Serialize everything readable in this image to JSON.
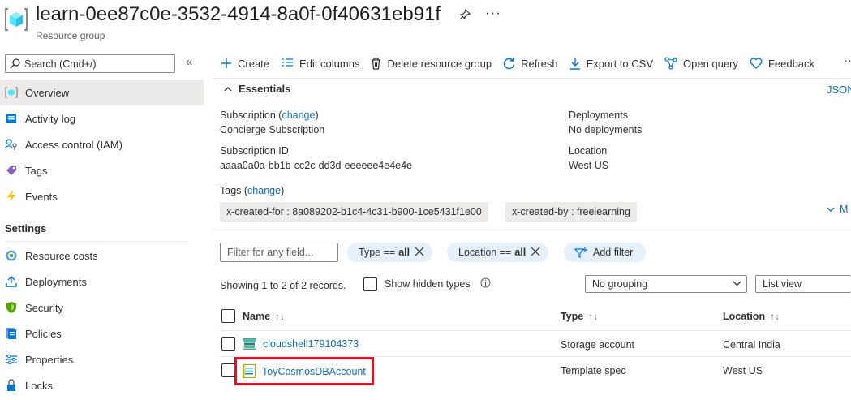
{
  "header": {
    "title": "learn-0ee87c0e-3532-4914-8a0f-0f40631eb91f",
    "subtitle": "Resource group",
    "more": "···"
  },
  "sidebar": {
    "search_placeholder": "Search (Cmd+/)",
    "collapse": "«",
    "items": [
      {
        "label": "Overview",
        "icon": "overview-icon",
        "active": true
      },
      {
        "label": "Activity log",
        "icon": "activity-log-icon"
      },
      {
        "label": "Access control (IAM)",
        "icon": "iam-icon"
      },
      {
        "label": "Tags",
        "icon": "tag-icon"
      },
      {
        "label": "Events",
        "icon": "events-icon"
      }
    ],
    "settings_heading": "Settings",
    "settings_items": [
      {
        "label": "Resource costs",
        "icon": "resource-costs-icon"
      },
      {
        "label": "Deployments",
        "icon": "deployments-icon"
      },
      {
        "label": "Security",
        "icon": "security-icon"
      },
      {
        "label": "Policies",
        "icon": "policies-icon"
      },
      {
        "label": "Properties",
        "icon": "properties-icon"
      },
      {
        "label": "Locks",
        "icon": "locks-icon"
      }
    ]
  },
  "toolbar": {
    "create": "Create",
    "edit_columns": "Edit columns",
    "delete_rg": "Delete resource group",
    "refresh": "Refresh",
    "export_csv": "Export to CSV",
    "open_query": "Open query",
    "feedback": "Feedback",
    "more": "···"
  },
  "essentials": {
    "heading": "Essentials",
    "json_view": "JSON",
    "subscription_label": "Subscription (",
    "change": "change",
    "close_paren": ")",
    "subscription_value": "Concierge Subscription",
    "subscription_id_label": "Subscription ID",
    "subscription_id_value": "aaaa0a0a-bb1b-cc2c-dd3d-eeeeee4e4e4e",
    "deployments_label": "Deployments",
    "deployments_value": "No deployments",
    "location_label": "Location",
    "location_value": "West US",
    "tags_label": "Tags (",
    "tags": [
      "x-created-for : 8a089202-b1c4-4c31-b900-1ce5431f1e00",
      "x-created-by : freelearning"
    ],
    "more_tags": "M"
  },
  "filters": {
    "filter_placeholder": "Filter for any field...",
    "type_pill": {
      "label": "Type ==",
      "value": "all"
    },
    "location_pill": {
      "label": "Location ==",
      "value": "all"
    },
    "add_filter": "Add filter"
  },
  "records": {
    "showing": "Showing 1 to 2 of 2 records.",
    "show_hidden": "Show hidden types",
    "grouping": "No grouping",
    "view": "List view"
  },
  "table": {
    "columns": {
      "name": "Name",
      "type": "Type",
      "location": "Location"
    },
    "rows": [
      {
        "name": "cloudshell179104373",
        "type": "Storage account",
        "location": "Central India",
        "icon": "storage-account-icon"
      },
      {
        "name": "ToyCosmosDBAccount",
        "type": "Template spec",
        "location": "West US",
        "icon": "template-spec-icon"
      }
    ]
  },
  "colors": {
    "accent": "#0f6cbd",
    "highlight": "#e81123",
    "pill_bg": "#e5f0fb"
  }
}
